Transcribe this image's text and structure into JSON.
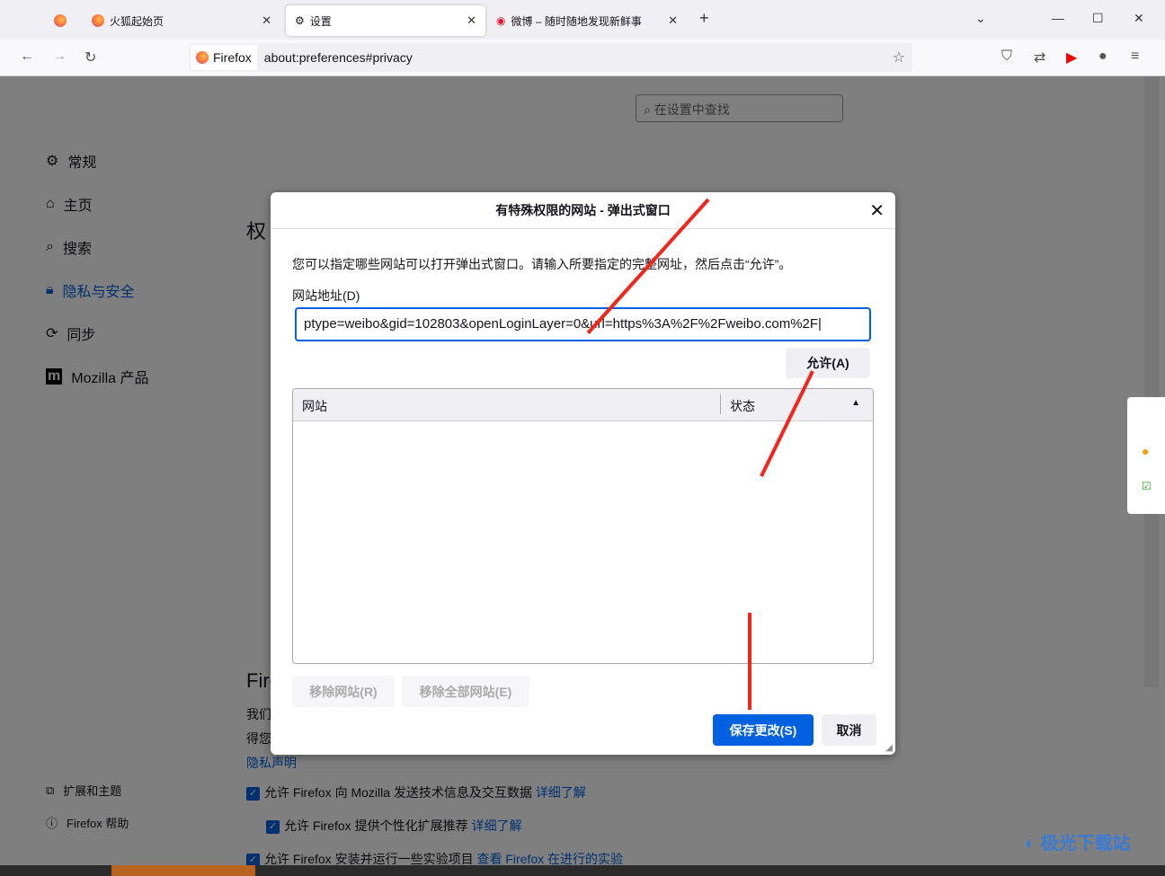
{
  "tabs": [
    {
      "label": "",
      "icon": "firefox-icon"
    },
    {
      "label": "火狐起始页",
      "icon": "firefox-icon"
    },
    {
      "label": "设置",
      "icon": "gear-icon",
      "active": true
    },
    {
      "label": "微博 – 随时随地发现新鲜事",
      "icon": "weibo-icon"
    }
  ],
  "identity": "Firefox",
  "url": "about:preferences#privacy",
  "search_placeholder": "在设置中查找",
  "sidebar": [
    {
      "label": "常规",
      "icon": "gear-icon"
    },
    {
      "label": "主页",
      "icon": "home-icon"
    },
    {
      "label": "搜索",
      "icon": "search-icon"
    },
    {
      "label": "隐私与安全",
      "icon": "lock-icon",
      "active": true
    },
    {
      "label": "同步",
      "icon": "sync-icon"
    },
    {
      "label": "Mozilla 产品",
      "icon": "mozilla-icon"
    }
  ],
  "sidebar_bottom": [
    {
      "label": "扩展和主题",
      "icon": "puzzle-icon"
    },
    {
      "label": "Firefox 帮助",
      "icon": "help-icon"
    }
  ],
  "content": {
    "heading1": "权",
    "heading2": "Fire",
    "line1": "我们",
    "line2": "得您",
    "privacy_link": "隐私声明",
    "options": [
      {
        "label": "允许 Firefox 向 Mozilla 发送技术信息及交互数据",
        "link": "详细了解"
      },
      {
        "label": "允许 Firefox 提供个性化扩展推荐",
        "link": "详细了解"
      },
      {
        "label": "允许 Firefox 安装并运行一些实验项目",
        "link": "查看 Firefox 在进行的实验"
      }
    ]
  },
  "dialog": {
    "title": "有特殊权限的网站 - 弹出式窗口",
    "description": "您可以指定哪些网站可以打开弹出式窗口。请输入所要指定的完整网址，然后点击“允许”。",
    "address_label": "网站地址(D)",
    "address_value": "ptype=weibo&gid=102803&openLoginLayer=0&url=https%3A%2F%2Fweibo.com%2F",
    "allow_button": "允许(A)",
    "col_site": "网站",
    "col_status": "状态",
    "remove_site": "移除网站(R)",
    "remove_all": "移除全部网站(E)",
    "save": "保存更改(S)",
    "cancel": "取消"
  },
  "watermark": "极光下载站",
  "colors": {
    "accent": "#0061e0",
    "arrow": "#f2261b"
  }
}
